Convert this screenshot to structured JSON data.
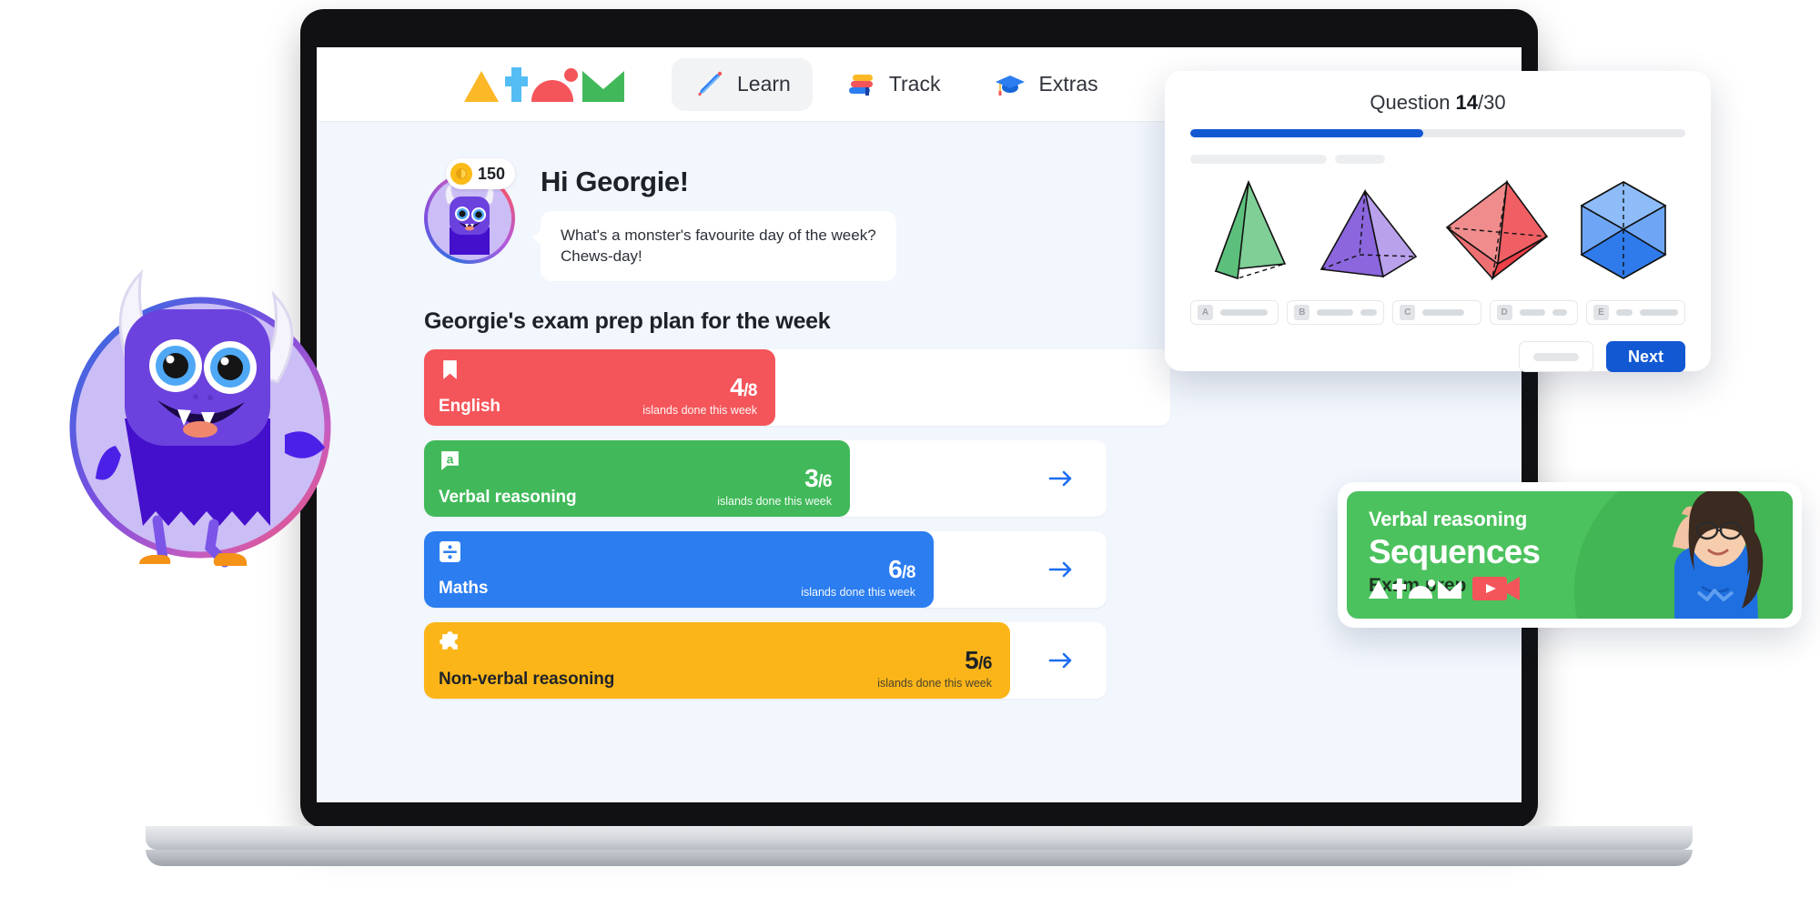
{
  "brand": {
    "name": "Atom",
    "logo_icon": "atom-logo",
    "colors": {
      "yellow": "#fcb827",
      "blue": "#54bdf4",
      "red": "#f4555a",
      "green": "#41b95a",
      "accent_blue": "#1258d3"
    }
  },
  "nav": {
    "items": [
      {
        "label": "Learn",
        "icon": "pencil-icon",
        "active": true
      },
      {
        "label": "Track",
        "icon": "books-stack-icon",
        "active": false
      },
      {
        "label": "Extras",
        "icon": "graduation-cap-icon",
        "active": false
      }
    ]
  },
  "greeting": {
    "coins": "150",
    "coin_icon": "coin-icon",
    "avatar_icon": "monster-avatar",
    "title": "Hi Georgie!",
    "joke_line_1": "What's a monster's favourite day of the week?",
    "joke_line_2": "Chews-day!"
  },
  "plan": {
    "title": "Georgie's exam prep plan for the week",
    "subtitle_suffix": "islands done this week",
    "arrow_icon": "arrow-right-icon",
    "subjects": [
      {
        "name": "English",
        "icon": "bookmark-icon",
        "done": "4",
        "total": "/8",
        "subtext": "islands done this week",
        "color": "#f4555a",
        "text_dark": false,
        "fill_pct": 47,
        "has_arrow": false
      },
      {
        "name": "Verbal reasoning",
        "icon": "speech-bubble-a-icon",
        "done": "3",
        "total": "/6",
        "subtext": "islands done this week",
        "color": "#41b95a",
        "text_dark": false,
        "fill_pct": 62,
        "has_arrow": true
      },
      {
        "name": "Maths",
        "icon": "division-icon",
        "done": "6",
        "total": "/8",
        "subtext": "islands done this week",
        "color": "#2b7df0",
        "text_dark": false,
        "fill_pct": 72,
        "has_arrow": true
      },
      {
        "name": "Non-verbal reasoning",
        "icon": "puzzle-piece-icon",
        "done": "5",
        "total": "/6",
        "subtext": "islands done this week",
        "color": "#fbb518",
        "text_dark": true,
        "fill_pct": 85,
        "has_arrow": true
      }
    ]
  },
  "question_panel": {
    "label_prefix": "Question ",
    "current": "14",
    "total": "/30",
    "progress_pct": 47,
    "shapes": [
      {
        "name": "triangular-pyramid",
        "color": "#6cc68a"
      },
      {
        "name": "square-pyramid",
        "color": "#9b7ddd"
      },
      {
        "name": "octahedron",
        "color": "#ef5f63"
      },
      {
        "name": "cube",
        "color": "#4a8ef0"
      }
    ],
    "options": [
      {
        "letter": "A",
        "skeleton_widths": [
          52
        ]
      },
      {
        "letter": "B",
        "skeleton_widths": [
          40,
          18
        ]
      },
      {
        "letter": "C",
        "skeleton_widths": [
          46
        ]
      },
      {
        "letter": "D",
        "skeleton_widths": [
          28,
          16
        ]
      },
      {
        "letter": "E",
        "skeleton_widths": [
          18,
          42
        ]
      }
    ],
    "back_button_label": "",
    "next_button_label": "Next"
  },
  "video_card": {
    "eyebrow": "Verbal reasoning",
    "title": "Sequences",
    "tag": "Exam prep",
    "logo_icon": "atom-logo-white",
    "video_icon": "video-camera-icon",
    "person_icon": "teacher-photo"
  },
  "mascot": {
    "icon": "monster-mascot"
  }
}
